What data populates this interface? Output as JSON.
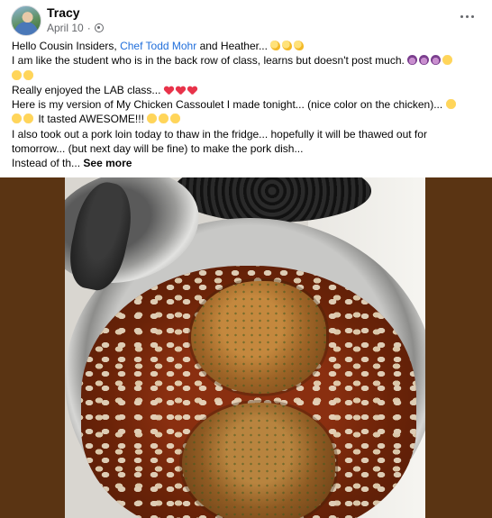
{
  "post": {
    "author": "Tracy",
    "date": "April 10",
    "privacy_icon": "globe-icon",
    "more_icon": "ellipsis-icon",
    "greeting_prefix": "Hello Cousin Insiders,",
    "greeting_mention": "Chef Todd Mohr",
    "greeting_suffix": "and Heather...",
    "line2": "I am like the student who is in the back row of class, learns but doesn't post much.",
    "line3": "Really enjoyed the LAB class...",
    "line4": "Here is my version of My Chicken Cassoulet I made tonight... (nice color on the chicken)...",
    "line5": "It tasted AWESOME!!!",
    "line6": "I also took out a pork loin today to thaw in the fridge... hopefully it will be thawed out for",
    "line7": "tomorrow... (but next day will be fine) to make the pork dish...",
    "line8": "Instead of th...",
    "see_more": "See more"
  },
  "colors": {
    "link": "#216fdb",
    "meta_text": "#65676b",
    "photo_frame": "#5a3413"
  }
}
